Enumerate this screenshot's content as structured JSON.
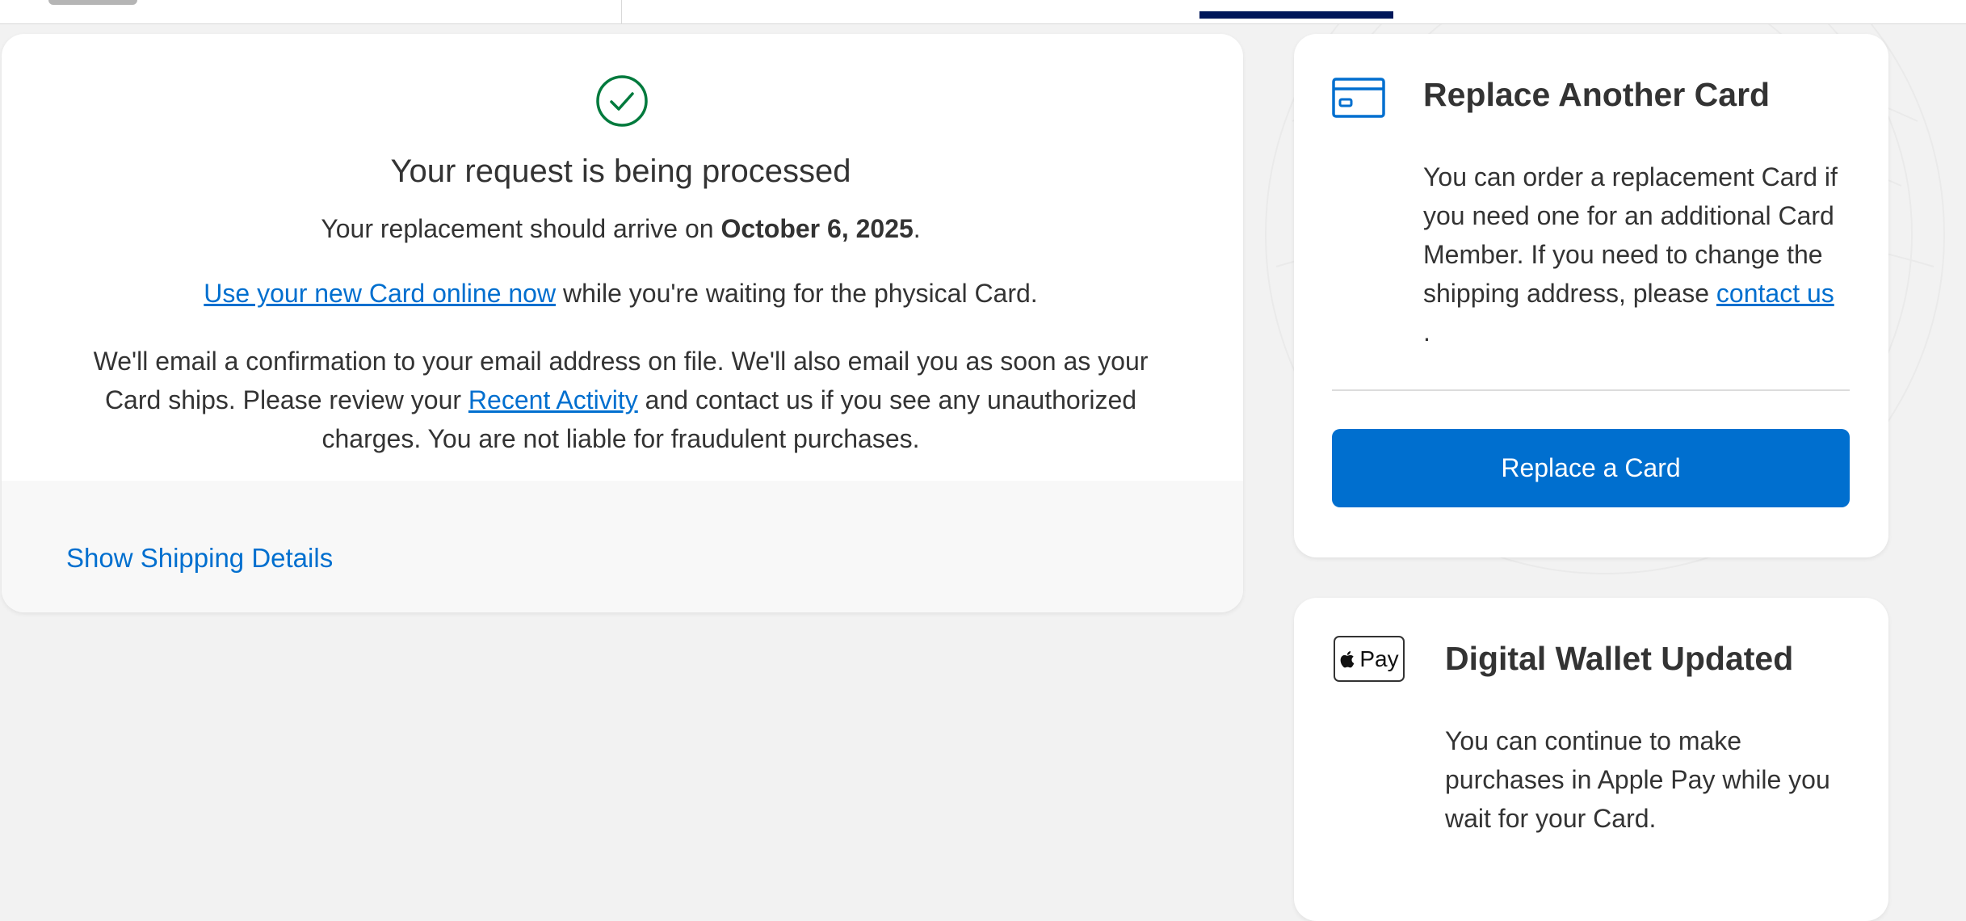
{
  "confirmation": {
    "headline": "Your request is being processed",
    "arrival_prefix": "Your replacement should arrive on ",
    "arrival_date": "October 6, 2025",
    "arrival_suffix": ".",
    "use_card_link": "Use your new Card online now",
    "use_card_suffix": " while you're waiting for the physical Card.",
    "email_text_1": "We'll email a confirmation to your email address on file. We'll also email you as soon as your Card ships. Please review your ",
    "recent_activity_link": "Recent Activity",
    "email_text_2": " and contact us if you see any unauthorized charges. You are not liable for fraudulent purchases.",
    "shipping_toggle": "Show Shipping Details"
  },
  "replace_another": {
    "title": "Replace Another Card",
    "body": "You can order a replacement Card if you need one for an additional Card Member. If you need to change the shipping address, please ",
    "contact_link": "contact us",
    "body_end": ".",
    "button_label": "Replace a Card"
  },
  "digital_wallet": {
    "title": "Digital Wallet Updated",
    "badge": "Pay",
    "body": "You can continue to make purchases in Apple Pay while you wait for your Card."
  },
  "colors": {
    "accent_blue": "#006fcf",
    "success_green": "#007a3d",
    "nav_indicator": "#00175a",
    "background": "#f2f2f2"
  },
  "icons": [
    "checkmark-circle-icon",
    "credit-card-icon",
    "apple-logo-icon"
  ]
}
